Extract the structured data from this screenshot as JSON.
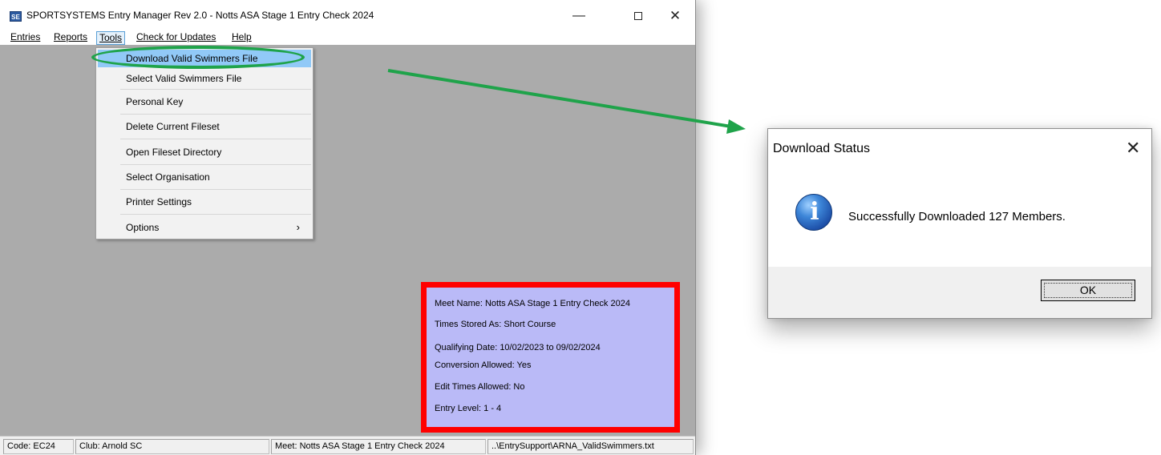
{
  "main_window": {
    "title": "SPORTSYSTEMS Entry Manager Rev 2.0 - Notts ASA Stage 1 Entry Check 2024",
    "icon_text": "SE",
    "minimize_glyph": "—",
    "close_glyph": "✕"
  },
  "menu": {
    "entries": "Entries",
    "reports": "Reports",
    "tools": "Tools",
    "check_updates": "Check for Updates",
    "help": "Help"
  },
  "tools_menu": {
    "items": [
      "Download Valid Swimmers File",
      "Select Valid Swimmers File",
      "Personal Key",
      "Delete Current Fileset",
      "Open Fileset Directory",
      "Select Organisation",
      "Printer Settings",
      "Options"
    ],
    "submenu_arrow": "›"
  },
  "meet_info": {
    "meet_name": "Meet Name: Notts ASA Stage 1 Entry Check 2024",
    "times_stored": "Times Stored As: Short Course",
    "qualifying_date": "Qualifying Date: 10/02/2023 to 09/02/2024",
    "conversion": "Conversion Allowed: Yes",
    "edit_times": "Edit Times Allowed: No",
    "entry_level": "Entry Level: 1 - 4"
  },
  "status_bar": {
    "code": "Code: EC24",
    "club": "Club: Arnold SC",
    "meet": "Meet: Notts ASA Stage 1 Entry Check 2024",
    "file": "..\\EntrySupport\\ARNA_ValidSwimmers.txt"
  },
  "dialog": {
    "title": "Download Status",
    "close_glyph": "✕",
    "icon_glyph": "i",
    "message": "Successfully Downloaded 127 Members.",
    "ok_label": "OK"
  },
  "colors": {
    "highlight_ring": "#1fa34a",
    "arrow": "#1fa34a",
    "info_border": "#ff0000",
    "info_fill": "#babaf7",
    "menu_highlight": "#91c9f7"
  }
}
